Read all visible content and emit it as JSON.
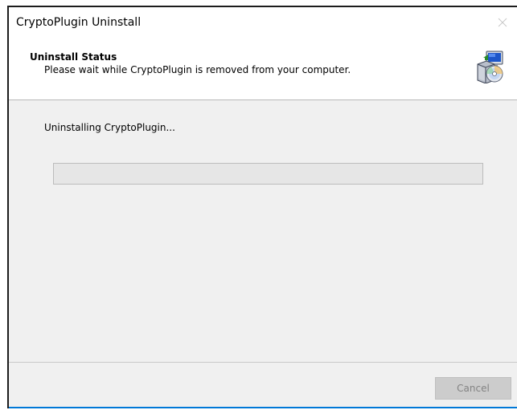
{
  "window": {
    "title": "CryptoPlugin Uninstall"
  },
  "header": {
    "title": "Uninstall Status",
    "subtitle": "Please wait while CryptoPlugin is removed from your computer.",
    "icon": "installer-computer-cd-icon"
  },
  "main": {
    "status_text": "Uninstalling CryptoPlugin...",
    "progress_percent": 0
  },
  "footer": {
    "cancel_label": "Cancel",
    "cancel_enabled": false
  },
  "colors": {
    "accent": "#0078d7",
    "progress": "#06b025"
  }
}
